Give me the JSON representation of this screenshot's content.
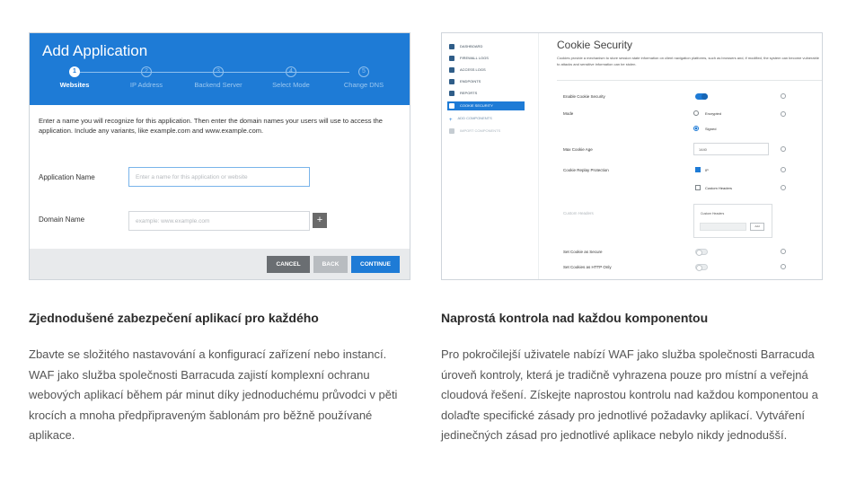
{
  "wizard": {
    "title": "Add Application",
    "steps": [
      {
        "num": "1",
        "label": "Websites",
        "active": true
      },
      {
        "num": "2",
        "label": "IP Address",
        "active": false
      },
      {
        "num": "3",
        "label": "Backend Server",
        "active": false
      },
      {
        "num": "4",
        "label": "Select Mode",
        "active": false
      },
      {
        "num": "5",
        "label": "Change DNS",
        "active": false
      }
    ],
    "intro": "Enter a name you will recognize for this application. Then enter the domain names your users will use to access the application. Include any variants, like example.com and www.example.com.",
    "app_name_label": "Application Name",
    "app_name_placeholder": "Enter a name for this application or website",
    "domain_label": "Domain Name",
    "domain_placeholder": "example: www.example.com",
    "add_domain_icon": "+",
    "buttons": {
      "cancel": "CANCEL",
      "back": "BACK",
      "continue": "CONTINUE"
    },
    "accent_color": "#1e7bd6"
  },
  "cookie": {
    "nav": [
      {
        "label": "DASHBOARD",
        "icon": "dashboard-icon",
        "state": "normal"
      },
      {
        "label": "FIREWALL LOGS",
        "icon": "logs-icon",
        "state": "normal"
      },
      {
        "label": "ACCESS LOGS",
        "icon": "access-logs-icon",
        "state": "normal"
      },
      {
        "label": "ENDPOINTS",
        "icon": "endpoints-icon",
        "state": "normal"
      },
      {
        "label": "REPORTS",
        "icon": "reports-icon",
        "state": "normal"
      },
      {
        "label": "COOKIE SECURITY",
        "icon": "cookie-icon",
        "state": "active"
      },
      {
        "label": "ADD COMPONENTS",
        "icon": "plus-icon",
        "state": "sub"
      },
      {
        "label": "IMPORT COMPONENTS",
        "icon": "import-icon",
        "state": "muted"
      }
    ],
    "title": "Cookie Security",
    "description": "Cookies provide a mechanism to store session state information on client navigation platforms, such as browsers and, if modified, the system can become vulnerable to attacks and sensitive information can be stolen.",
    "enable_label": "Enable Cookie Security",
    "mode_label": "Mode",
    "mode_options": [
      "Encrypted",
      "Signed"
    ],
    "max_age_label": "Max Cookie Age",
    "max_age_value": "1440",
    "replay_label": "Cookie Replay Protection",
    "replay_options": [
      "IP",
      "Custom Headers"
    ],
    "custom_headers_label": "Custom Headers",
    "custom_headers_panel_title": "Custom Headers",
    "custom_headers_add": "Add",
    "secure_label": "Set Cookie as Secure",
    "http_only_label": "Set Cookies as HTTP Only"
  },
  "left_column": {
    "heading": "Zjednodušené zabezpečení aplikací pro každého",
    "body": "Zbavte se složitého nastavování a konfigurací zařízení nebo instancí. WAF jako služba společnosti Barracuda zajistí komplexní ochranu webových aplikací během pár minut díky jednoduchému průvodci v pěti krocích a mnoha předpřipraveným šablonám pro běžně používané aplikace."
  },
  "right_column": {
    "heading": "Naprostá kontrola nad každou komponentou",
    "body": "Pro pokročilejší uživatele nabízí WAF jako služba společnosti Barracuda úroveň kontroly, která je tradičně vyhrazena pouze pro místní a veřejná cloudová řešení. Získejte naprostou kontrolu nad každou komponentou a dolaďte specifické zásady pro jednotlivé požadavky aplikací. Vytváření jedinečných zásad pro jednotlivé aplikace nebylo nikdy jednodušší."
  }
}
